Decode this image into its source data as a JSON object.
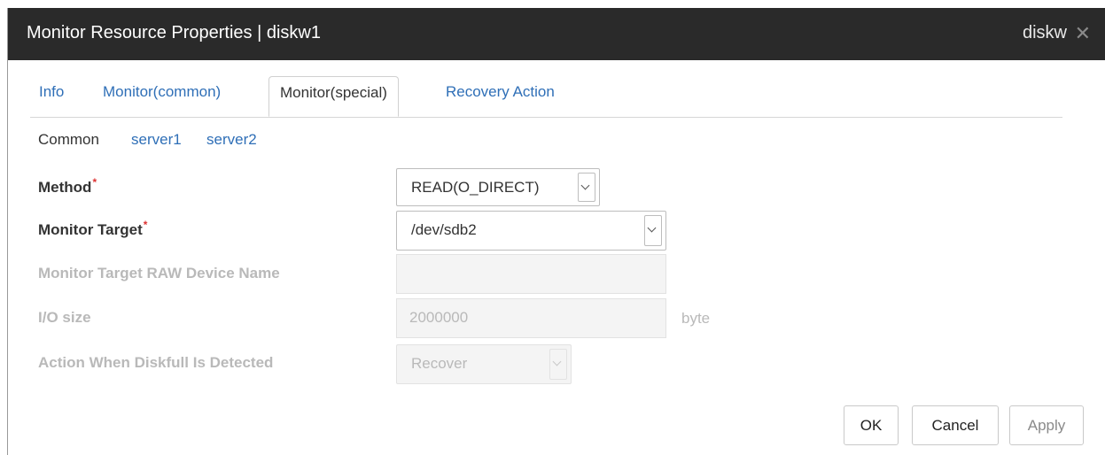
{
  "window": {
    "title": "Monitor Resource Properties | diskw1",
    "type_label": "diskw",
    "close_glyph": "✕"
  },
  "tabs": [
    {
      "label": "Info",
      "active": false
    },
    {
      "label": "Monitor(common)",
      "active": false
    },
    {
      "label": "Monitor(special)",
      "active": true
    },
    {
      "label": "Recovery Action",
      "active": false
    }
  ],
  "server_tabs": {
    "common": "Common",
    "server1": "server1",
    "server2": "server2"
  },
  "form": {
    "required_mark": "*",
    "method": {
      "label": "Method",
      "value": "READ(O_DIRECT)"
    },
    "monitor_target": {
      "label": "Monitor Target",
      "value": "/dev/sdb2"
    },
    "raw_device": {
      "label": "Monitor Target RAW Device Name",
      "value": ""
    },
    "io_size": {
      "label": "I/O size",
      "value": "2000000",
      "unit": "byte"
    },
    "diskfull_action": {
      "label": "Action When Diskfull Is Detected",
      "value": "Recover"
    }
  },
  "buttons": {
    "ok": "OK",
    "cancel": "Cancel",
    "apply": "Apply"
  },
  "colors": {
    "titlebar": "#2a2a2a",
    "link": "#2f6fb7",
    "required": "#dd3333",
    "disabled_text": "#b9b9b9"
  }
}
